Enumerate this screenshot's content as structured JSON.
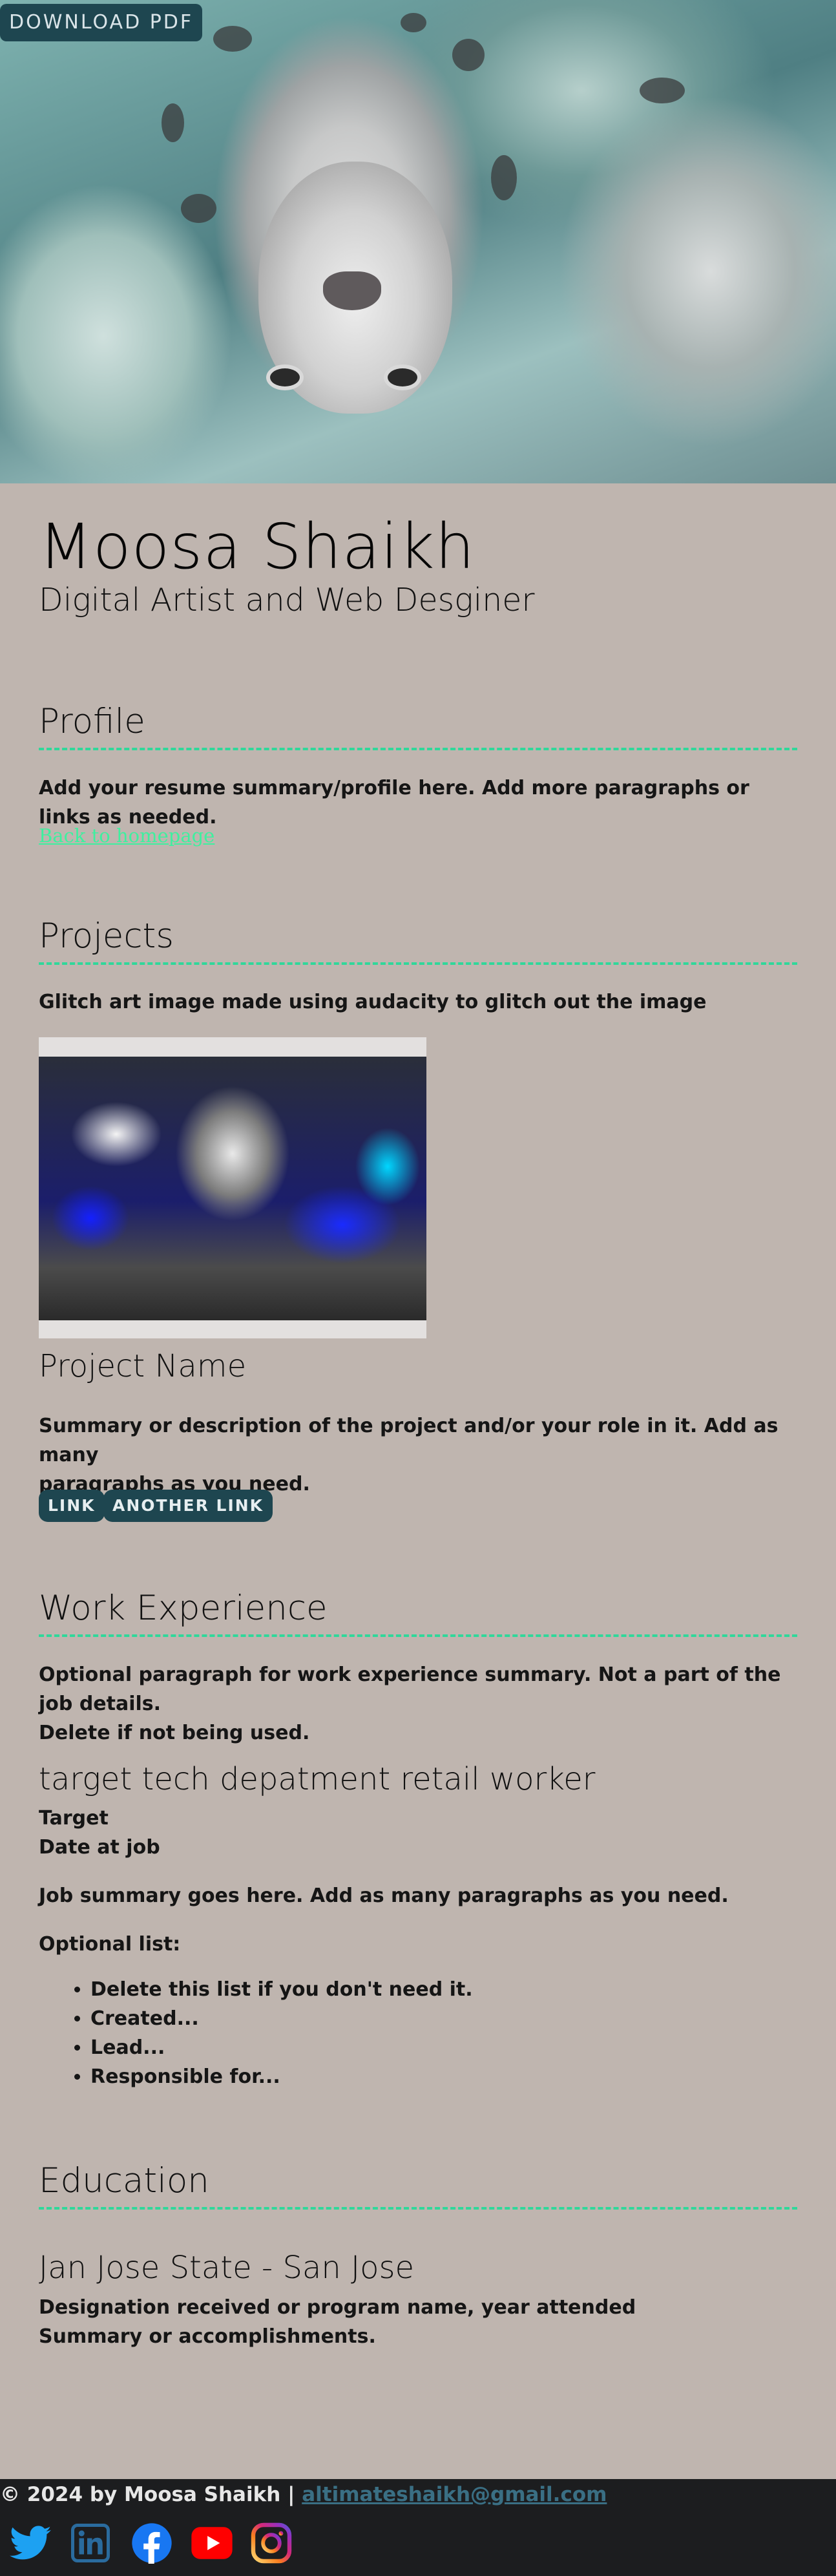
{
  "header": {
    "download_label": "DOWNLOAD PDF"
  },
  "intro": {
    "name": "Moosa Shaikh",
    "tagline": "Digital Artist and Web Desginer"
  },
  "profile": {
    "title": "Profile",
    "text": "Add your resume summary/profile here. Add more paragraphs or links as needed.",
    "back_link": "Back to homepage"
  },
  "projects": {
    "title": "Projects",
    "caption": "Glitch art image made using audacity to glitch out the image",
    "project_name": "Project Name",
    "summary_line1": "Summary or description of the project and/or your role in it. Add as many",
    "summary_line2": "paragraphs as you need.",
    "link1": "LINK",
    "link2": "ANOTHER LINK"
  },
  "work": {
    "title": "Work Experience",
    "summary_line1": "Optional paragraph for work experience summary. Not a part of the job details.",
    "summary_line2": "Delete if not being used.",
    "job_title": "target tech depatment retail worker",
    "company": "Target",
    "date": "Date at job",
    "job_summary": "Job summary goes here. Add as many paragraphs as you need.",
    "optional_list_label": "Optional list:",
    "list_items": [
      "Delete this list if you don't need it.",
      "Created...",
      "Lead...",
      "Responsible for..."
    ]
  },
  "education": {
    "title": "Education",
    "school": "Jan Jose State - San Jose",
    "designation": "Designation received or program name, year attended",
    "accomplishments": "Summary or accomplishments."
  },
  "footer": {
    "copyright": "© 2024 by Moosa Shaikh |",
    "email": "altimateshaikh@gmail.com",
    "social": [
      "twitter-icon",
      "linkedin-icon",
      "facebook-icon",
      "youtube-icon",
      "instagram-icon"
    ]
  },
  "colors": {
    "background": "#bfb5af",
    "accent_dashed": "#2fd89a",
    "button": "#1e4650",
    "footer": "#1c1d1f",
    "link": "#3ef09f"
  }
}
